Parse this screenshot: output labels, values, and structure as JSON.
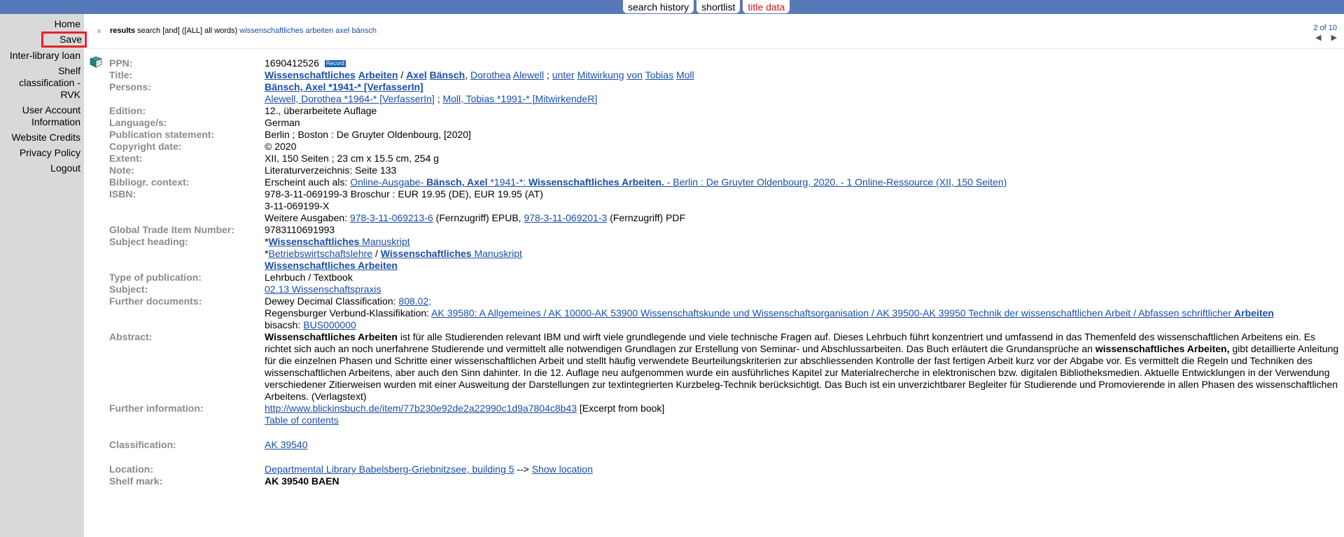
{
  "tabs": [
    {
      "label": "search history",
      "active": false
    },
    {
      "label": "shortlist",
      "active": false
    },
    {
      "label": "title data",
      "active": true
    }
  ],
  "sidebar": {
    "home": "Home",
    "save": "Save",
    "ill": "Inter-library loan",
    "shelf": [
      "Shelf",
      "classification -",
      "RVK"
    ],
    "account": [
      "User Account",
      "Information"
    ],
    "credits": "Website Credits",
    "privacy": "Privacy Policy",
    "logout": "Logout"
  },
  "results": {
    "prefix": "results",
    "search": "search [and] ([ALL] all words)",
    "terms": "wissenschaftliches arbeiten axel bänsch"
  },
  "pager": {
    "position": "2 of 10",
    "prev": "◀",
    "next": "▶"
  },
  "record": {
    "ppn_label": "PPN:",
    "ppn": "1690412526",
    "record_badge": "Record",
    "title_label": "Title:",
    "persons_label": "Persons:",
    "p1": "Bänsch, Axel *1941-* [VerfasserIn]",
    "p2": "Alewell, Dorothea *1964-* [VerfasserIn]",
    "p3": "Moll, Tobias *1991-* [MitwirkendeR]",
    "edition_label": "Edition:",
    "edition": "12., überarbeitete Auflage",
    "language_label": "Language/s:",
    "language": "German",
    "pub_label": "Publication statement:",
    "pub": "Berlin ; Boston : De Gruyter Oldenbourg, [2020]",
    "copy_label": "Copyright date:",
    "copy": "© 2020",
    "extent_label": "Extent:",
    "extent": "XII, 150 Seiten ; 23 cm x 15.5 cm, 254 g",
    "note_label": "Note:",
    "note": "Literaturverzeichnis: Seite 133",
    "biblio_label": "Bibliogr. context:",
    "biblio_prefix": "Erscheint auch als:",
    "biblio_link": "Online-Ausgabe",
    "isbn_label": "ISBN:",
    "isbn1": "978-3-11-069199-3 Broschur : EUR 19.95 (DE), EUR 19.95 (AT)",
    "isbn2": "3-11-069199-X",
    "isbn3_prefix": "Weitere Ausgaben:",
    "isbn3_a": "978-3-11-069213-6",
    "isbn3_mid": "(Fernzugriff) EPUB,",
    "isbn3_b": "978-3-11-069201-3",
    "isbn3_end": "(Fernzugriff) PDF",
    "gtin_label": "Global Trade Item Number:",
    "gtin": "9783110691993",
    "subjh_label": "Subject heading:",
    "type_label": "Type of publication:",
    "type": "Lehrbuch / Textbook",
    "subject_label": "Subject:",
    "subject": "02.13 Wissenschaftspraxis",
    "further_label": "Further documents:",
    "fd1_prefix": "Dewey Decimal Classification:",
    "fd1_link": "808.02;",
    "fd2_prefix": "Regensburger Verbund-Klassifikation:",
    "fd2_link": "AK 39580: A Allgemeines / AK 10000-AK 53900 Wissenschaftskunde und Wissenschaftsorganisation / AK 39500-AK 39950 Technik der wissenschaftlichen Arbeit / Abfassen schriftlicher",
    "fd2_bold": "Arbeiten",
    "fd3_prefix": "bisacsh:",
    "fd3_link": "BUS000000",
    "abstract_label": "Abstract:",
    "abstract_b1": "Wissenschaftliches Arbeiten",
    "abstract_t1": " ist für alle Studierenden relevant IBM und wirft viele grundlegende und viele technische Fragen auf. Dieses Lehrbuch führt konzentriert und umfassend in das Themenfeld des wissenschaftlichen Arbeitens ein. Es richtet sich auch an noch unerfahrene Studierende und vermittelt alle notwendigen Grundlagen zur Erstellung von Seminar- und Abschlussarbeiten. Das Buch erläutert die Grundansprüche an ",
    "abstract_b2": "wissenschaftliches Arbeiten,",
    "abstract_t2": " gibt detaillierte Anleitung für die einzelnen Phasen und Schritte einer wissenschaftlichen Arbeit und stellt häufig verwendete Beurteilungskriterien zur abschliessenden Kontrolle der fast fertigen Arbeit kurz vor der Abgabe vor. Es vermittelt die Regeln und Techniken des wissenschaftlichen Arbeitens, aber auch den Sinn dahinter. In die 12. Auflage neu aufgenommen wurde ein ausführliches Kapitel zur Materialrecherche in elektronischen bzw. digitalen Bibliotheksmedien. Aktuelle Entwicklungen in der Verwendung verschiedener Zitierweisen wurden mit einer Ausweitung der Darstellungen zur textintegrierten Kurzbeleg-Technik berücksichtigt. Das Buch ist ein unverzichtbarer Begleiter für Studierende und Promovierende in allen Phasen des wissenschaftlichen Arbeitens. (Verlagstext)",
    "info_label": "Further information:",
    "info_link": "http://www.blickinsbuch.de/item/77b230e92de2a22990c1d9a7804c8b43",
    "info_suffix": "[Excerpt from book]",
    "toc": "Table of contents",
    "class_label": "Classification:",
    "class": "AK 39540",
    "loc_label": "Location:",
    "loc": "Departmental Library Babelsberg-Griebnitzsee, building 5",
    "loc_arrow": "-->",
    "show_loc": "Show location",
    "shelf_label": "Shelf mark:",
    "shelf": "AK 39540 BAEN"
  }
}
